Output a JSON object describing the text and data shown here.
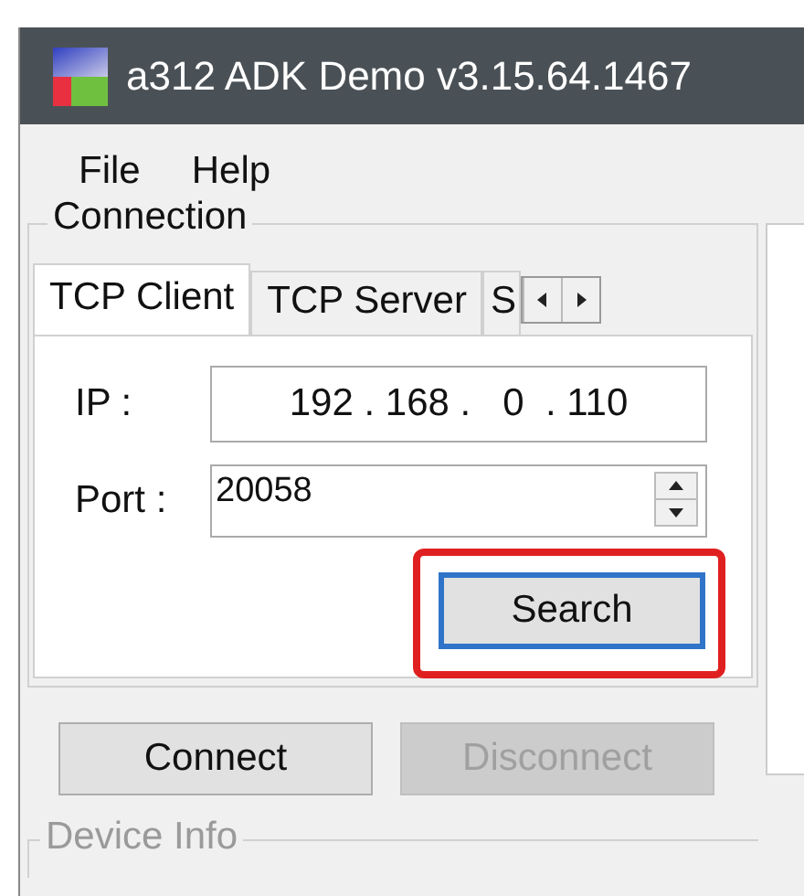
{
  "window": {
    "title": "a312 ADK Demo v3.15.64.1467"
  },
  "menu": [
    "File",
    "Help"
  ],
  "connection": {
    "title": "Connection",
    "tabs": [
      {
        "label": "TCP Client",
        "selected": true
      },
      {
        "label": "TCP Server",
        "selected": false
      },
      {
        "label": "S",
        "selected": false
      }
    ],
    "ip": {
      "label": "IP :",
      "value": "192 . 168 .   0  . 110"
    },
    "port": {
      "label": "Port :",
      "value": "20058"
    },
    "search_button": {
      "label": "Search",
      "focused": true,
      "highlighted": true
    },
    "buttons": [
      {
        "label": "Connect",
        "disabled": false
      },
      {
        "label": "Disconnect",
        "disabled": true
      }
    ]
  },
  "device_info": {
    "title": "Device Info",
    "disabled": true
  }
}
